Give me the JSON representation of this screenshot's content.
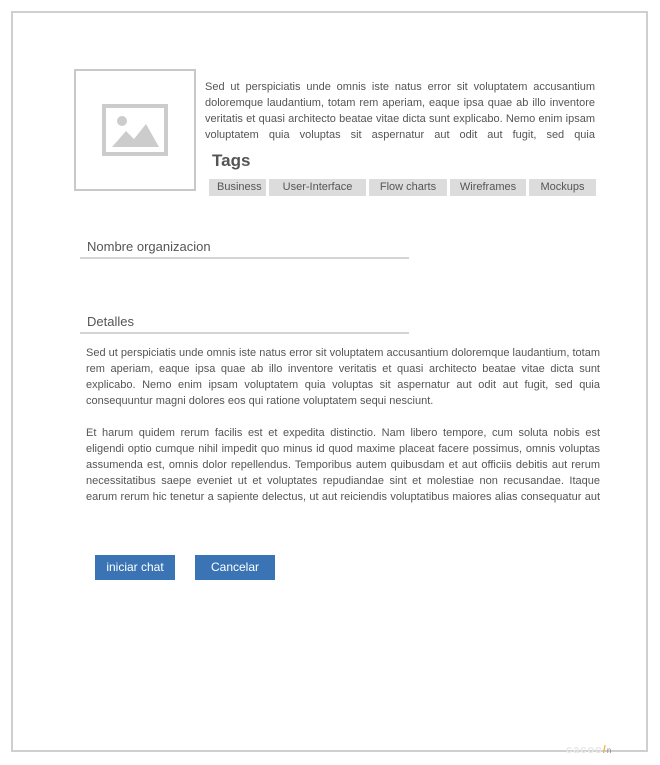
{
  "intro": {
    "text": "Sed ut perspiciatis unde omnis iste natus error sit voluptatem accusantium doloremque laudantium, totam rem aperiam, eaque ipsa quae ab illo inventore veritatis et quasi architecto beatae vitae dicta sunt explicabo. Nemo enim ipsam voluptatem quia voluptas sit aspernatur aut odit aut fugit, sed quia consequuntur magni dolores eos qui ratione voluptatem sequi nesciunt."
  },
  "tags": {
    "title": "Tags",
    "items": [
      "Business",
      "User-Interface",
      "Flow charts",
      "Wireframes",
      "Mockups"
    ]
  },
  "fields": {
    "organization_label": "Nombre organizacion",
    "details_label": "Detalles"
  },
  "details": {
    "paragraph1": "Sed ut perspiciatis unde omnis iste natus error sit voluptatem accusantium doloremque laudantium, totam rem aperiam, eaque ipsa quae ab illo inventore veritatis et quasi architecto beatae vitae dicta sunt explicabo. Nemo enim ipsam voluptatem quia voluptas sit aspernatur aut odit aut fugit, sed quia consequuntur magni dolores eos qui ratione voluptatem sequi nesciunt.",
    "paragraph2": "Et harum quidem rerum facilis est et expedita distinctio. Nam libero tempore, cum soluta nobis est eligendi optio cumque nihil impedit quo minus id quod maxime placeat facere possimus, omnis voluptas assumenda est, omnis dolor repellendus. Temporibus autem quibusdam et aut officiis debitis aut rerum necessitatibus saepe eveniet ut et voluptates repudiandae sint et molestiae non recusandae. Itaque earum rerum hic tenetur a sapiente delectus, ut aut reiciendis voluptatibus maiores alias consequatur aut perferendis doloribus asperiores repellat."
  },
  "buttons": {
    "start_chat": "iniciar chat",
    "cancel": "Cancelar"
  },
  "colors": {
    "button": "#3a74b5",
    "tag_bg": "#dcdcdc",
    "text": "#555555"
  }
}
